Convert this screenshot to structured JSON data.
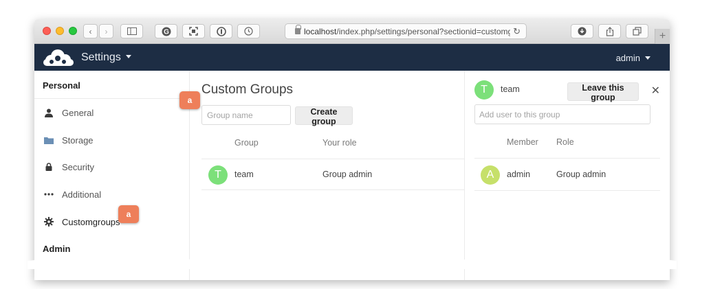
{
  "browser": {
    "url_host": "localhost",
    "url_path": "/index.php/settings/personal?sectionid=customgro",
    "reload_icon": "reload-icon"
  },
  "header": {
    "app_title": "Settings",
    "user_menu": "admin"
  },
  "sidebar": {
    "personal_heading": "Personal",
    "items": [
      {
        "label": "General",
        "icon": "user-icon"
      },
      {
        "label": "Storage",
        "icon": "folder-icon"
      },
      {
        "label": "Security",
        "icon": "lock-icon"
      },
      {
        "label": "Additional",
        "icon": "more-icon"
      },
      {
        "label": "Customgroups",
        "icon": "gear-icon"
      }
    ],
    "admin_heading": "Admin"
  },
  "main": {
    "title": "Custom Groups",
    "group_name_placeholder": "Group name",
    "create_button": "Create group",
    "columns": [
      "Group",
      "Your role"
    ],
    "rows": [
      {
        "avatar_letter": "T",
        "group": "team",
        "role": "Group admin"
      }
    ]
  },
  "panel": {
    "avatar_letter": "T",
    "group_name": "team",
    "leave_button": "Leave this group",
    "close": "✕",
    "add_user_placeholder": "Add user to this group",
    "columns": [
      "Member",
      "Role"
    ],
    "rows": [
      {
        "avatar_letter": "A",
        "member": "admin",
        "role": "Group admin"
      }
    ]
  },
  "annotations": {
    "badge_1": "a",
    "badge_2": "a"
  },
  "colors": {
    "header_bg": "#1d2d44",
    "avatar_team": "#7ce07a",
    "avatar_admin": "#c6e06a",
    "badge": "#ee7f5a"
  }
}
